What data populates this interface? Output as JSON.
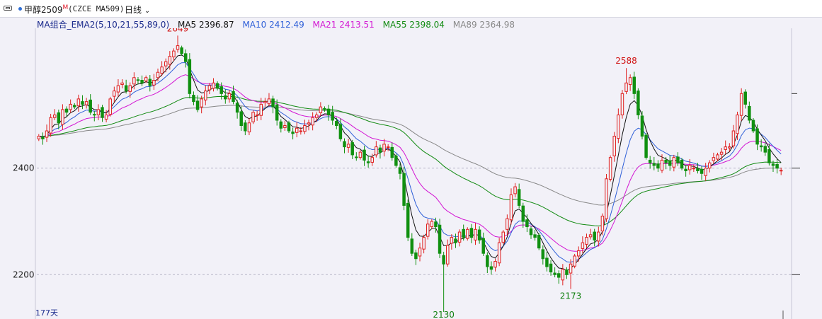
{
  "header": {
    "symbol": "甲醇2509",
    "badge": "M",
    "code": "(CZCE MA509)",
    "period": "日线"
  },
  "legend": {
    "indicator": "MA组合_EMA2(5,10,21,55,89,0)",
    "items": [
      {
        "label": "MA5 2396.87",
        "color": "#111111"
      },
      {
        "label": "MA10 2412.49",
        "color": "#2e5fd8"
      },
      {
        "label": "MA21 2413.51",
        "color": "#d316d3"
      },
      {
        "label": "MA55 2398.04",
        "color": "#118a11"
      },
      {
        "label": "MA89 2364.98",
        "color": "#888888"
      }
    ]
  },
  "footer": {
    "days": "177天"
  },
  "chart_data": {
    "type": "candlestick",
    "ylim": [
      2130,
      2660
    ],
    "y_ticks": [
      "2400",
      "2200"
    ],
    "grid": "dashed horizontal at ticks",
    "colors": {
      "up": "#e02020",
      "down": "#109010",
      "ma5": "#111111",
      "ma10": "#2e5fd8",
      "ma21": "#d316d3",
      "ma55": "#118a11",
      "ma89": "#888888"
    },
    "annotations": [
      {
        "text": "2649",
        "index": 35,
        "value": 2649,
        "color": "#d01010"
      },
      {
        "text": "2588",
        "index": 148,
        "value": 2588,
        "color": "#d01010"
      },
      {
        "text": "2130",
        "index": 102,
        "value": 2130,
        "color": "#108010"
      },
      {
        "text": "2173",
        "index": 134,
        "value": 2173,
        "color": "#108010"
      }
    ],
    "closes": [
      2460,
      2455,
      2470,
      2495,
      2500,
      2485,
      2510,
      2505,
      2520,
      2515,
      2530,
      2520,
      2525,
      2505,
      2500,
      2510,
      2495,
      2500,
      2530,
      2545,
      2555,
      2560,
      2545,
      2555,
      2570,
      2565,
      2560,
      2570,
      2555,
      2565,
      2580,
      2590,
      2600,
      2610,
      2620,
      2630,
      2615,
      2600,
      2540,
      2525,
      2510,
      2530,
      2545,
      2555,
      2560,
      2550,
      2540,
      2530,
      2540,
      2525,
      2505,
      2480,
      2470,
      2485,
      2505,
      2500,
      2520,
      2525,
      2530,
      2515,
      2490,
      2475,
      2480,
      2470,
      2465,
      2475,
      2470,
      2480,
      2485,
      2495,
      2500,
      2515,
      2510,
      2500,
      2490,
      2480,
      2455,
      2440,
      2445,
      2425,
      2420,
      2430,
      2415,
      2410,
      2420,
      2440,
      2430,
      2445,
      2440,
      2420,
      2405,
      2390,
      2330,
      2270,
      2240,
      2230,
      2250,
      2270,
      2295,
      2300,
      2290,
      2240,
      2220,
      2255,
      2270,
      2260,
      2280,
      2270,
      2285,
      2270,
      2285,
      2265,
      2240,
      2215,
      2210,
      2225,
      2260,
      2280,
      2305,
      2350,
      2365,
      2330,
      2300,
      2290,
      2275,
      2270,
      2250,
      2230,
      2215,
      2205,
      2200,
      2195,
      2210,
      2200,
      2220,
      2235,
      2245,
      2260,
      2270,
      2275,
      2265,
      2280,
      2310,
      2380,
      2420,
      2460,
      2500,
      2540,
      2560,
      2570,
      2540,
      2500,
      2460,
      2420,
      2410,
      2405,
      2400,
      2415,
      2410,
      2405,
      2420,
      2410,
      2400,
      2395,
      2405,
      2400,
      2395,
      2390,
      2400,
      2410,
      2420,
      2425,
      2430,
      2440,
      2440,
      2470,
      2500,
      2540,
      2520,
      2490,
      2470,
      2445,
      2440,
      2430,
      2410,
      2405,
      2400,
      2396
    ]
  }
}
